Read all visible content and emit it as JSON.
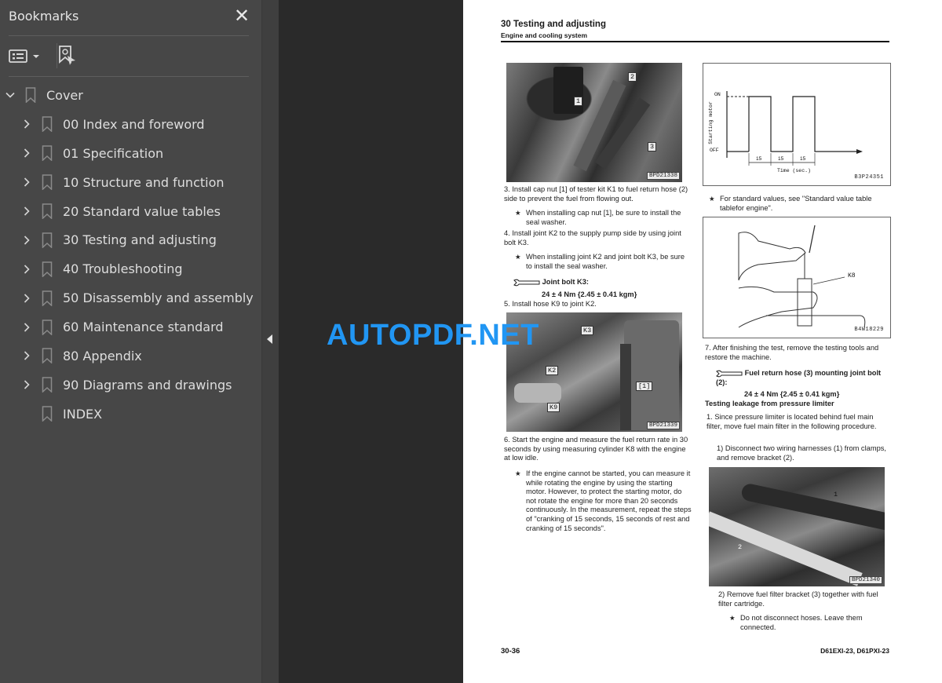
{
  "sidebar": {
    "title": "Bookmarks",
    "close_icon": "close-icon",
    "tools": {
      "options_icon": "list-options-icon",
      "find_bookmark_icon": "find-current-bookmark-icon"
    },
    "items": [
      {
        "label": "Cover",
        "expanded": true,
        "has_children": true,
        "level": 0
      },
      {
        "label": "00 Index and foreword",
        "expanded": false,
        "has_children": true,
        "level": 1
      },
      {
        "label": "01 Specification",
        "expanded": false,
        "has_children": true,
        "level": 1
      },
      {
        "label": "10 Structure and function",
        "expanded": false,
        "has_children": true,
        "level": 1
      },
      {
        "label": "20 Standard value tables",
        "expanded": false,
        "has_children": true,
        "level": 1
      },
      {
        "label": "30 Testing and adjusting",
        "expanded": false,
        "has_children": true,
        "level": 1
      },
      {
        "label": "40 Troubleshooting",
        "expanded": false,
        "has_children": true,
        "level": 1
      },
      {
        "label": "50 Disassembly and assembly",
        "expanded": false,
        "has_children": true,
        "level": 1
      },
      {
        "label": "60 Maintenance standard",
        "expanded": false,
        "has_children": true,
        "level": 1
      },
      {
        "label": "80 Appendix",
        "expanded": false,
        "has_children": true,
        "level": 1
      },
      {
        "label": "90 Diagrams and drawings",
        "expanded": false,
        "has_children": true,
        "level": 1
      },
      {
        "label": "INDEX",
        "expanded": false,
        "has_children": false,
        "level": 1
      }
    ]
  },
  "watermark": "AUTOPDF.NET",
  "page": {
    "title": "30 Testing and adjusting",
    "subtitle": "Engine and cooling system",
    "page_number": "30-36",
    "model": "D61EXI-23, D61PXI-23",
    "left_col": {
      "photo1": {
        "code": "BPD21338",
        "callouts": [
          "1",
          "2",
          "3"
        ]
      },
      "step3": "3. Install cap nut [1] of tester kit K1 to fuel return hose (2) side to prevent the fuel from flowing out.",
      "note3": "When installing cap nut [1], be sure to install the seal washer.",
      "step4": "4. Install joint K2 to the supply pump side by using joint bolt K3.",
      "note4": "When installing joint K2 and joint bolt K3, be sure to install the seal washer.",
      "torque1_label": "Joint bolt K3:",
      "torque1_value": "24 ± 4 Nm {2.45 ± 0.41 kgm}",
      "step5": "5. Install hose K9 to joint K2.",
      "photo2": {
        "code": "BPD21339",
        "callouts": [
          "K3",
          "K2",
          "[1]",
          "K9"
        ]
      },
      "step6": "6. Start the engine and measure the fuel return rate in 30 seconds by using measuring cylinder K8 with the engine at low idle.",
      "note6": "If the engine cannot be started, you can measure it while rotating the engine by using the starting motor. However, to protect the starting motor, do not rotate the engine for more than 20 seconds continuously. In the measurement, repeat the steps of \"cranking of 15 seconds, 15 seconds of rest and cranking of 15 seconds\"."
    },
    "right_col": {
      "timing_diagram": {
        "code": "B3P24351",
        "y_label": "Starting motor",
        "on_label": "ON",
        "off_label": "OFF",
        "x_label": "Time (sec.)",
        "intervals": [
          "15",
          "15",
          "15"
        ]
      },
      "note_std": "For standard values, see \"Standard value table tablefor engine\".",
      "illustration": {
        "code": "B4W18229",
        "callout": "K8"
      },
      "step7": "7. After finishing the test, remove the testing tools and restore the machine.",
      "torque2_label": "Fuel return hose (3) mounting joint bolt (2):",
      "torque2_value": "24 ± 4 Nm {2.45 ± 0.41 kgm}",
      "section_heading": "Testing leakage from pressure limiter",
      "step1": "1. Since pressure limiter is located behind fuel main filter, move fuel main filter in the following procedure.",
      "sub1": "1) Disconnect two wiring harnesses (1) from clamps, and remove bracket (2).",
      "photo3": {
        "code": "BPD21340",
        "callouts": [
          "1",
          "2"
        ]
      },
      "sub2": "2) Remove fuel filter bracket (3) together with fuel filter cartridge.",
      "note_sub2": "Do not disconnect hoses. Leave them connected."
    }
  }
}
